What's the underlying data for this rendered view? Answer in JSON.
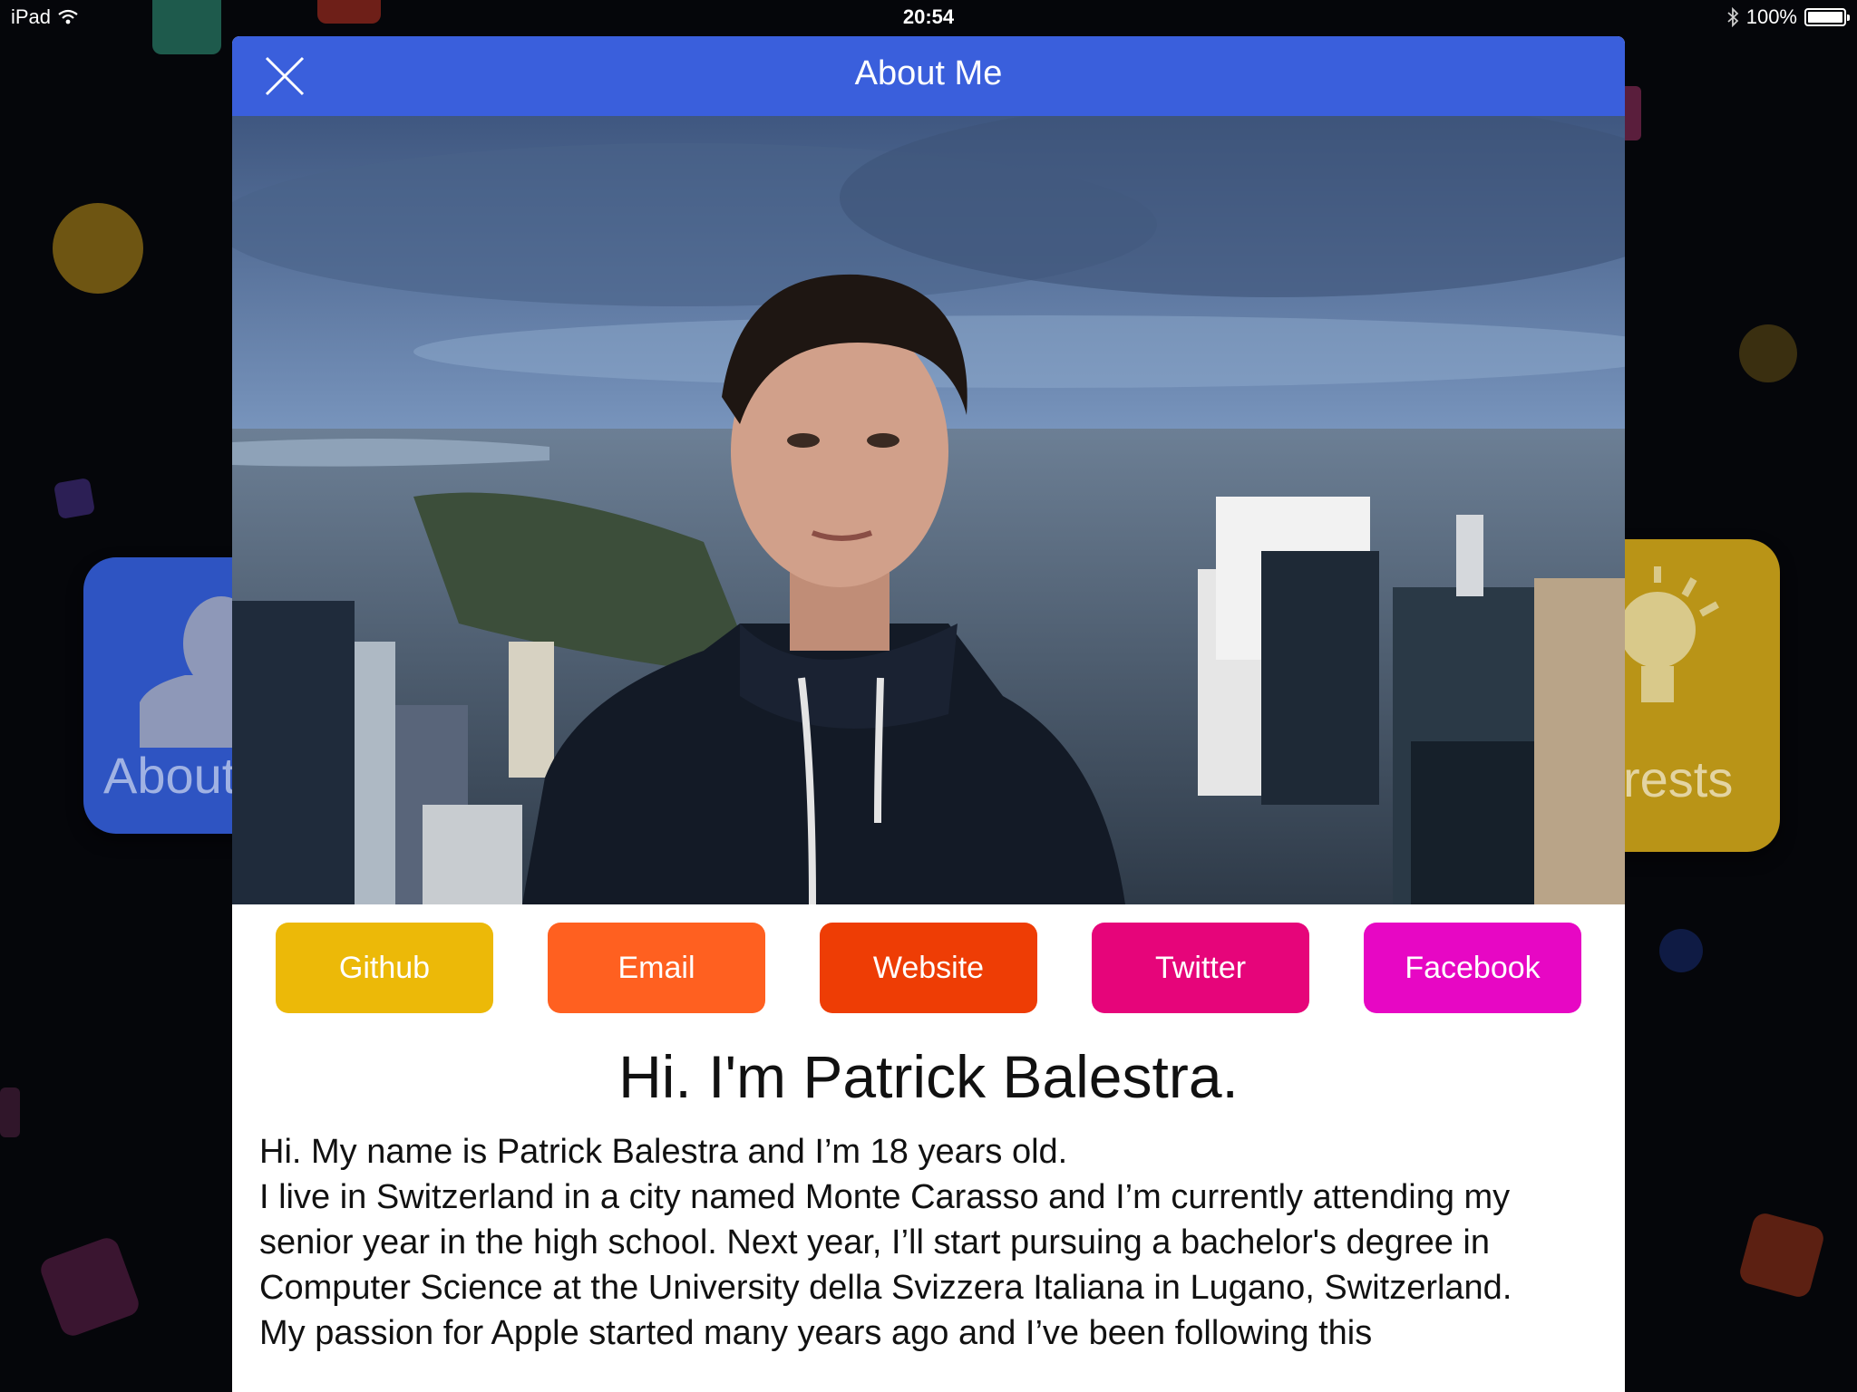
{
  "status_bar": {
    "device": "iPad",
    "time": "20:54",
    "battery": "100%",
    "battery_level": 1.0
  },
  "background": {
    "tile_left_label": "About",
    "tile_right_label": "rests"
  },
  "modal": {
    "title": "About Me",
    "accent_color": "#3a5fdc",
    "buttons": [
      {
        "label": "Github",
        "color": "#ecb908"
      },
      {
        "label": "Email",
        "color": "#ff6020"
      },
      {
        "label": "Website",
        "color": "#ee3d05"
      },
      {
        "label": "Twitter",
        "color": "#e6057a"
      },
      {
        "label": "Facebook",
        "color": "#e707c4"
      }
    ],
    "heading": "Hi. I'm Patrick Balestra.",
    "bio": [
      "Hi. My name is Patrick Balestra and I’m 18 years old.",
      "I live in Switzerland in a city named Monte Carasso and I’m currently attending my senior year in the high school. Next year, I’ll start pursuing a bachelor's degree in Computer Science at the University della Svizzera Italiana in Lugano, Switzerland.",
      "My passion for Apple started many years ago and I’ve been following this"
    ]
  }
}
